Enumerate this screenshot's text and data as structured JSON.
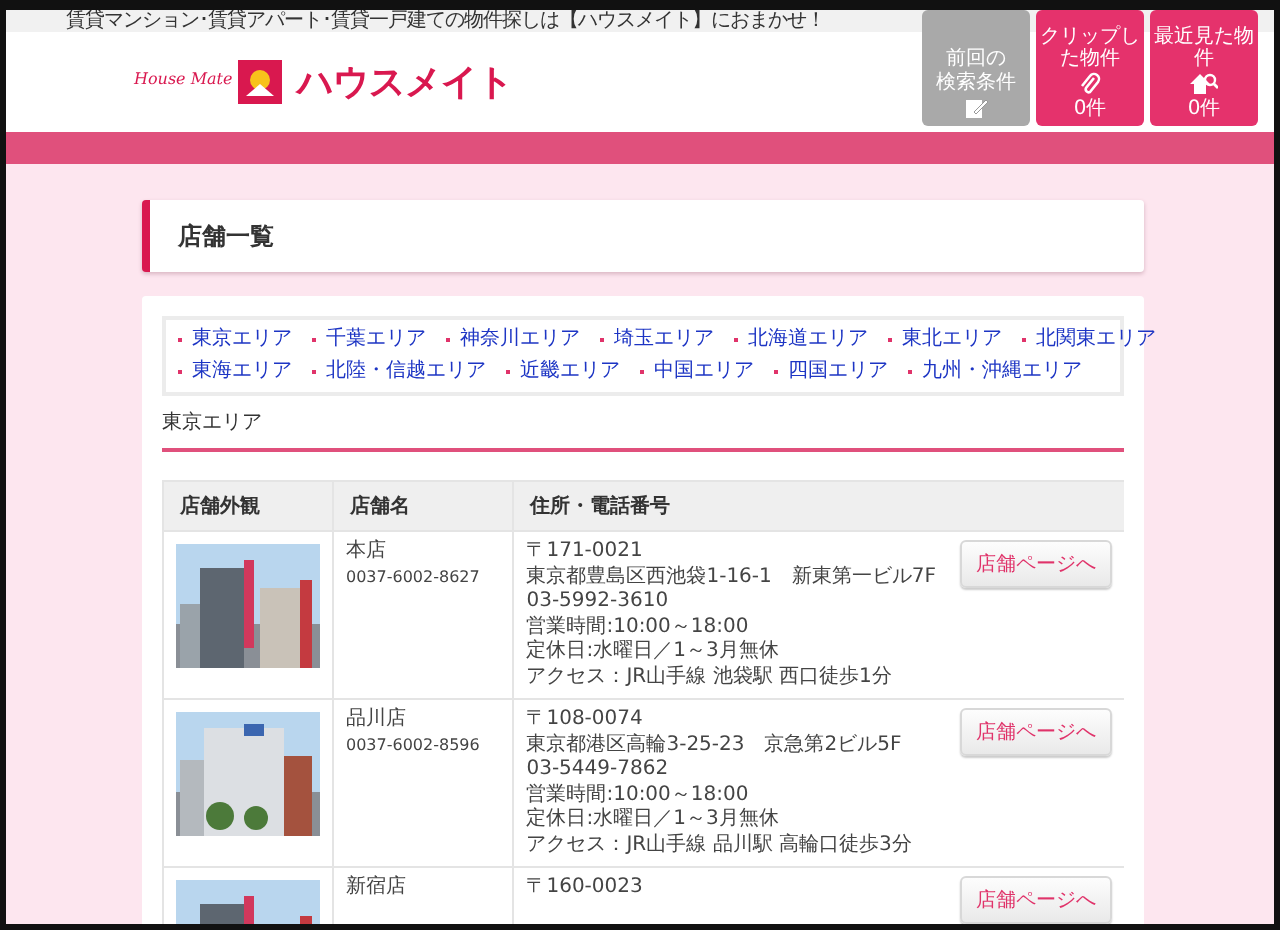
{
  "tagline": "賃貸マンション･賃貸アパート･賃貸一戸建ての物件探しは【ハウスメイト】におまかせ！",
  "logo": {
    "script_text": "House Mate",
    "name": "ハウスメイト"
  },
  "header_tiles": [
    {
      "kind": "history",
      "lines": [
        "前回の",
        "検索条件"
      ]
    },
    {
      "kind": "clip",
      "lines": [
        "クリップした物件"
      ],
      "count": "0件"
    },
    {
      "kind": "recent",
      "lines": [
        "最近見た物件"
      ],
      "count": "0件"
    }
  ],
  "page_title": "店舗一覧",
  "area_links": [
    [
      "東京エリア",
      "千葉エリア",
      "神奈川エリア",
      "埼玉エリア",
      "北海道エリア",
      "東北エリア",
      "北関東エリア"
    ],
    [
      "東海エリア",
      "北陸・信越エリア",
      "近畿エリア",
      "中国エリア",
      "四国エリア",
      "九州・沖縄エリア"
    ]
  ],
  "section_title": "東京エリア",
  "table": {
    "columns": [
      "店舗外観",
      "店舗名",
      "住所・電話番号"
    ],
    "rows": [
      {
        "name": "本店",
        "phone": "0037-6002-8627",
        "address_lines": [
          "〒171-0021",
          "東京都豊島区西池袋1-16-1　新東第一ビル7F",
          "03-5992-3610",
          "営業時間:10:00～18:00",
          "定休日:水曜日／1～3月無休",
          "アクセス：JR山手線 池袋駅 西口徒歩1分"
        ],
        "button": "店舗ページへ"
      },
      {
        "name": "品川店",
        "phone": "0037-6002-8596",
        "address_lines": [
          "〒108-0074",
          "東京都港区高輪3-25-23　京急第2ビル5F",
          "03-5449-7862",
          "営業時間:10:00～18:00",
          "定休日:水曜日／1～3月無休",
          "アクセス：JR山手線 品川駅 高輪口徒歩3分"
        ],
        "button": "店舗ページへ"
      },
      {
        "name": "新宿店",
        "address_lines": [
          "〒160-0023"
        ],
        "button": "店舗ページへ"
      }
    ]
  }
}
